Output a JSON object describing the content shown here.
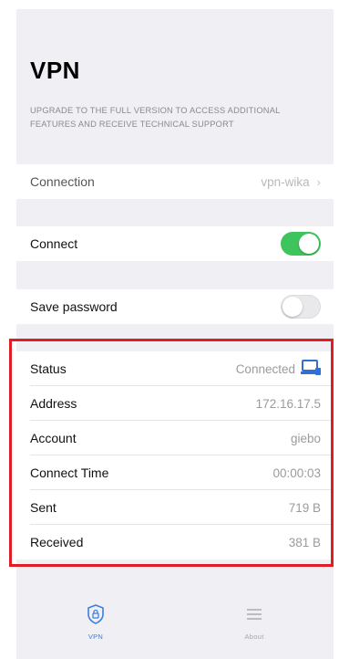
{
  "header": {
    "title": "VPN",
    "notice": "UPGRADE TO THE FULL VERSION TO ACCESS ADDITIONAL FEATURES AND RECEIVE TECHNICAL SUPPORT"
  },
  "settings": {
    "connection": {
      "label": "Connection",
      "value": "vpn-wika"
    },
    "connect": {
      "label": "Connect",
      "enabled": true
    },
    "save_password": {
      "label": "Save password",
      "enabled": false
    }
  },
  "status_section": {
    "status": {
      "label": "Status",
      "value": "Connected",
      "icon": "computer-icon"
    },
    "address": {
      "label": "Address",
      "value": "172.16.17.5"
    },
    "account": {
      "label": "Account",
      "value": "giebo"
    },
    "connect_time": {
      "label": "Connect Time",
      "value": "00:00:03"
    },
    "sent": {
      "label": "Sent",
      "value": "719 B"
    },
    "received": {
      "label": "Received",
      "value": "381 B"
    }
  },
  "tabbar": {
    "tabs": [
      {
        "label": "VPN",
        "icon": "vpn-shield-icon",
        "active": true
      },
      {
        "label": "About",
        "icon": "list-icon",
        "active": false
      }
    ]
  },
  "colors": {
    "accent": "#3b7fe0",
    "toggle_on": "#3ec45c",
    "highlight_border": "#e01c24",
    "background": "#efeff4"
  }
}
